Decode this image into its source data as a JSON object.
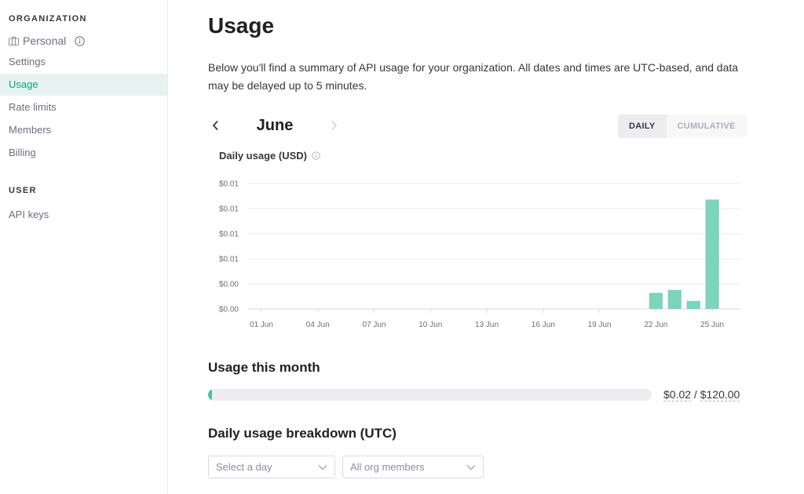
{
  "sidebar": {
    "org_heading": "ORGANIZATION",
    "org_name": "Personal",
    "org_items": [
      {
        "label": "Settings",
        "active": false
      },
      {
        "label": "Usage",
        "active": true
      },
      {
        "label": "Rate limits",
        "active": false
      },
      {
        "label": "Members",
        "active": false
      },
      {
        "label": "Billing",
        "active": false
      }
    ],
    "user_heading": "USER",
    "user_items": [
      {
        "label": "API keys",
        "active": false
      }
    ]
  },
  "main": {
    "title": "Usage",
    "intro": "Below you'll find a summary of API usage for your organization. All dates and times are UTC-based, and data may be delayed up to 5 minutes.",
    "month": "June",
    "view_toggle": {
      "daily": "DAILY",
      "cumulative": "CUMULATIVE",
      "selected": "daily"
    },
    "chart_title": "Daily usage (USD)",
    "usage_month_title": "Usage this month",
    "usage_used": "$0.02",
    "usage_separator": " / ",
    "usage_limit": "$120.00",
    "usage_fraction": 0.000167,
    "breakdown_title": "Daily usage breakdown (UTC)",
    "day_select_placeholder": "Select a day",
    "member_select_value": "All org members"
  },
  "colors": {
    "accent": "#10a37f",
    "bar": "#7dd3bb",
    "grid": "#ececf1"
  },
  "chart_data": {
    "type": "bar",
    "title": "Daily usage (USD)",
    "xlabel": "",
    "ylabel": "",
    "categories": [
      "01 Jun",
      "02 Jun",
      "03 Jun",
      "04 Jun",
      "05 Jun",
      "06 Jun",
      "07 Jun",
      "08 Jun",
      "09 Jun",
      "10 Jun",
      "11 Jun",
      "12 Jun",
      "13 Jun",
      "14 Jun",
      "15 Jun",
      "16 Jun",
      "17 Jun",
      "18 Jun",
      "19 Jun",
      "20 Jun",
      "21 Jun",
      "22 Jun",
      "23 Jun",
      "24 Jun",
      "25 Jun",
      "26 Jun"
    ],
    "values": [
      0,
      0,
      0,
      0,
      0,
      0,
      0,
      0,
      0,
      0,
      0,
      0,
      0,
      0,
      0,
      0,
      0,
      0,
      0,
      0,
      0,
      0.0016,
      0.0019,
      0.0008,
      0.0109,
      0
    ],
    "x_tick_labels": [
      "01 Jun",
      "04 Jun",
      "07 Jun",
      "10 Jun",
      "13 Jun",
      "16 Jun",
      "19 Jun",
      "22 Jun",
      "25 Jun"
    ],
    "y_ticks": [
      0,
      0.0025,
      0.005,
      0.0075,
      0.01,
      0.0125
    ],
    "y_tick_labels": [
      "$0.00",
      "$0.00",
      "$0.01",
      "$0.01",
      "$0.01",
      "$0.01"
    ],
    "ylim": [
      0,
      0.0125
    ],
    "grid": true,
    "legend": "none"
  }
}
